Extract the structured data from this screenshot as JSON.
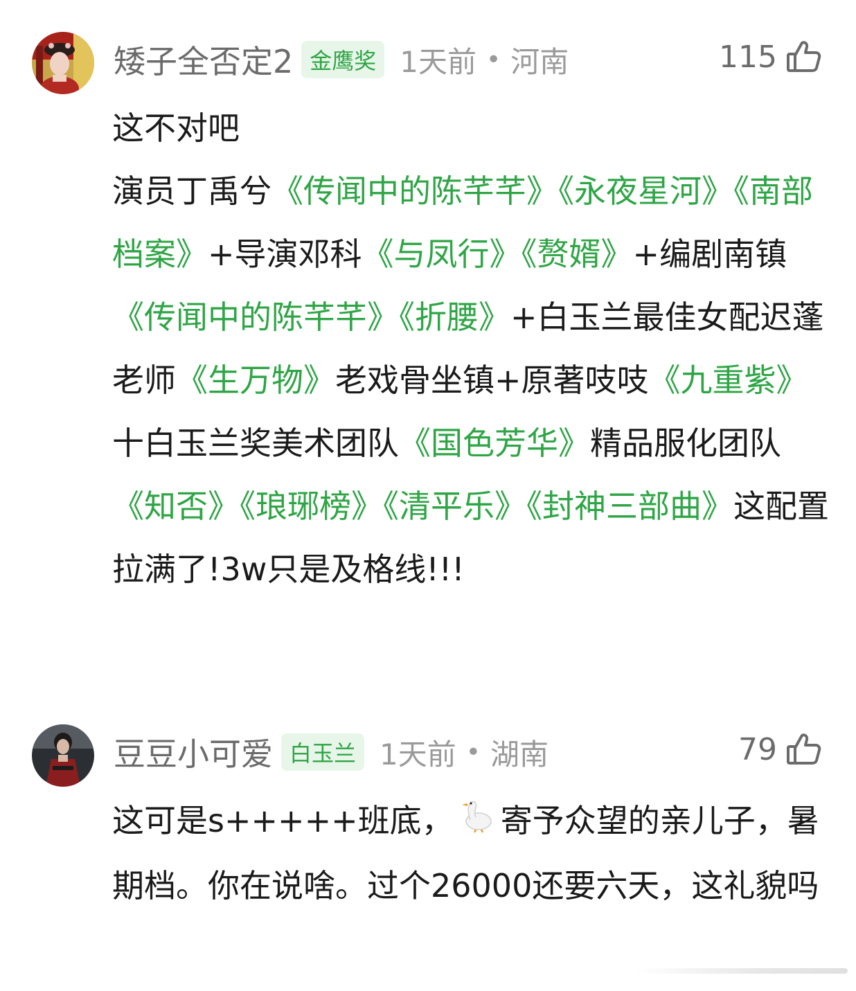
{
  "comments": [
    {
      "username": "矮子全否定2",
      "badge": "金鹰奖",
      "time": "1天前",
      "separator": "•",
      "location": "河南",
      "likes": "115",
      "segments": [
        {
          "text": "这不对吧",
          "style": "plain",
          "br_after": true
        },
        {
          "text": "演员丁禹兮",
          "style": "plain"
        },
        {
          "text": "《传闻中的陈芊芊》《永夜星河》《南部档案》",
          "style": "green"
        },
        {
          "text": "+导演邓科",
          "style": "plain"
        },
        {
          "text": "《与凤行》《赘婿》",
          "style": "green"
        },
        {
          "text": "+编剧南镇",
          "style": "plain"
        },
        {
          "text": "《传闻中的陈芊芊》《折腰》",
          "style": "green"
        },
        {
          "text": "+白玉兰最佳女配迟蓬老师",
          "style": "plain"
        },
        {
          "text": "《生万物》",
          "style": "green"
        },
        {
          "text": "老戏骨坐镇+原著吱吱",
          "style": "plain"
        },
        {
          "text": "《九重紫》",
          "style": "green"
        },
        {
          "text": "十白玉兰奖美术团队",
          "style": "plain"
        },
        {
          "text": "《国色芳华》",
          "style": "green"
        },
        {
          "text": "精品服化团队",
          "style": "plain"
        },
        {
          "text": "《知否》《琅琊榜》《清平乐》《封神三部曲》",
          "style": "green"
        },
        {
          "text": "这配置拉满了!3w只是及格线!!!",
          "style": "plain"
        }
      ]
    },
    {
      "username": "豆豆小可爱",
      "badge": "白玉兰",
      "time": "1天前",
      "separator": "•",
      "location": "湖南",
      "likes": "79",
      "segments": [
        {
          "text": "这可是s+++++班底，",
          "style": "plain"
        },
        {
          "text": "",
          "style": "emoji",
          "icon": "goose-emoji"
        },
        {
          "text": "寄予众望的亲儿子，暑期档。你在说啥。过个26000还要六天，这礼貌吗",
          "style": "plain"
        }
      ]
    }
  ],
  "colors": {
    "highlight": "#2fa546",
    "badge_bg": "#e8f6ea",
    "meta": "#9a9a9a",
    "username": "#6b6b6b",
    "text": "#1a1a1a"
  },
  "icons": {
    "like": "thumbs-up-icon",
    "emoji": "goose-emoji"
  }
}
